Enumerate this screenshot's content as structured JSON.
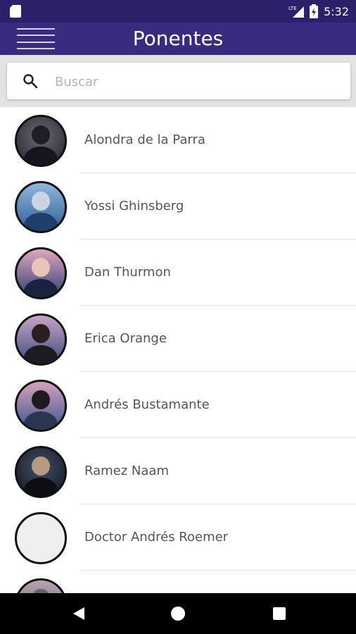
{
  "status_bar": {
    "time": "5:32",
    "network_label": "LTE",
    "icons": [
      "sim-card-icon",
      "signal-icon",
      "battery-charging-icon"
    ]
  },
  "app_bar": {
    "title": "Ponentes",
    "menu_icon": "hamburger-menu-icon"
  },
  "search": {
    "placeholder": "Buscar",
    "value": "",
    "icon": "search-icon"
  },
  "speakers": [
    {
      "name": "Alondra de la Parra",
      "has_photo": true,
      "tint": "#3a3a44"
    },
    {
      "name": "Yossi Ghinsberg",
      "has_photo": true,
      "tint": "#5a86b8"
    },
    {
      "name": "Dan Thurmon",
      "has_photo": true,
      "tint": "#c58fa8"
    },
    {
      "name": "Erica Orange",
      "has_photo": true,
      "tint": "#b08cae"
    },
    {
      "name": "Andrés Bustamante",
      "has_photo": true,
      "tint": "#b58aa6"
    },
    {
      "name": "Ramez Naam",
      "has_photo": true,
      "tint": "#2b2f3b"
    },
    {
      "name": "Doctor Andrés Roemer",
      "has_photo": false,
      "tint": "#efefef"
    },
    {
      "name": "",
      "has_photo": true,
      "tint": "#9a8ea0"
    }
  ],
  "nav_bar": {
    "icons": [
      "back-icon",
      "home-icon",
      "recent-apps-icon"
    ]
  },
  "colors": {
    "status_bar": "#2e1f6b",
    "app_bar": "#3a2a80",
    "search_area": "#e3e3e3",
    "text": "#555555"
  }
}
